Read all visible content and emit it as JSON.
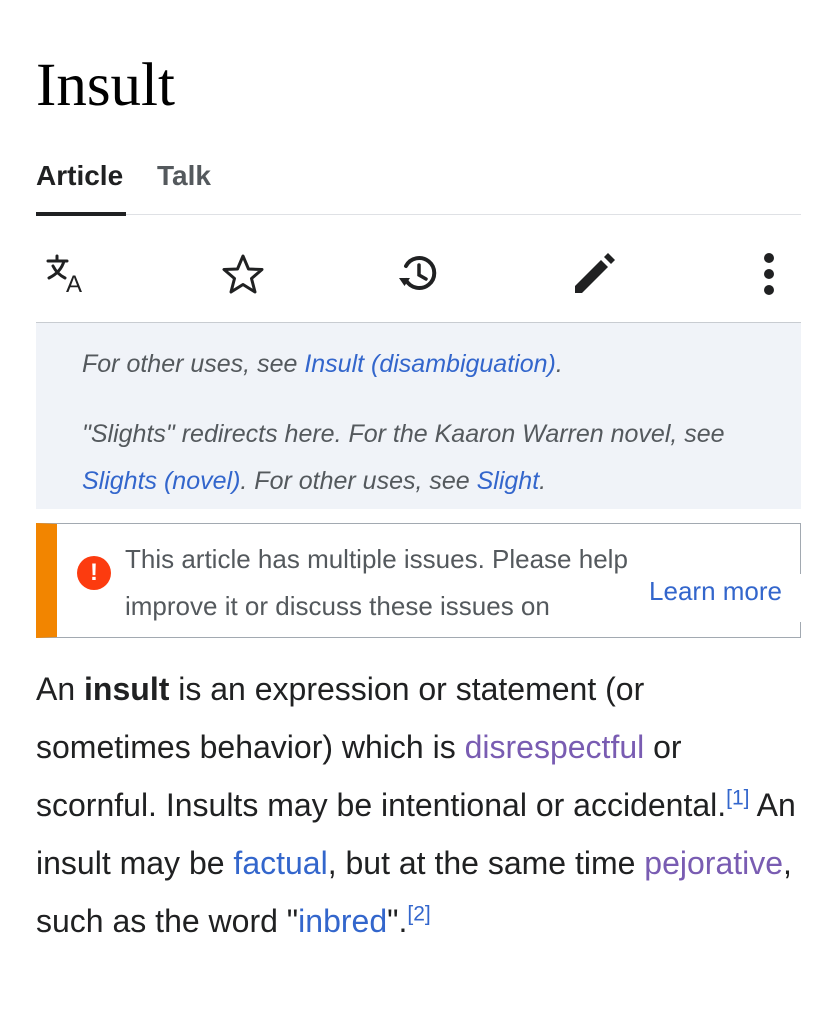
{
  "page": {
    "title": "Insult"
  },
  "tabs": [
    {
      "label": "Article",
      "active": true
    },
    {
      "label": "Talk",
      "active": false
    }
  ],
  "toolbar": {
    "icons": [
      "language-icon",
      "star-icon",
      "history-icon",
      "edit-icon",
      "more-icon"
    ]
  },
  "hatnotes": {
    "note1": {
      "prefix": "For other uses, see ",
      "link": "Insult (disambiguation)",
      "suffix": "."
    },
    "note2": {
      "prefix": "\"Slights\" redirects here. For the Kaaron Warren novel, see ",
      "link1": "Slights (novel)",
      "middle": ". For other uses, see ",
      "link2": "Slight",
      "suffix": "."
    }
  },
  "issues": {
    "text": "This article has multiple issues. Please help improve it or discuss these issues on",
    "learn_more": "Learn more",
    "accent_color": "#f28500",
    "icon_color": "#fc3b0f"
  },
  "article": {
    "p1": "An ",
    "bold": "insult",
    "p2": " is an expression or statement (or sometimes behavior) which is ",
    "link_disrespectful": "disrespectful",
    "p3": " or scornful. Insults may be intentional or accidental.",
    "ref1": "[1]",
    "p4": " An insult may be ",
    "link_factual": "factual",
    "p5": ", but at the same time ",
    "link_pejorative": "pejorative",
    "p6": ", such as the word \"",
    "link_inbred": "inbred",
    "p7": "\".",
    "ref2": "[2]"
  },
  "colors": {
    "link": "#3366cc",
    "visited_link": "#795cb2",
    "hatnote_bg": "#f0f3f8"
  }
}
